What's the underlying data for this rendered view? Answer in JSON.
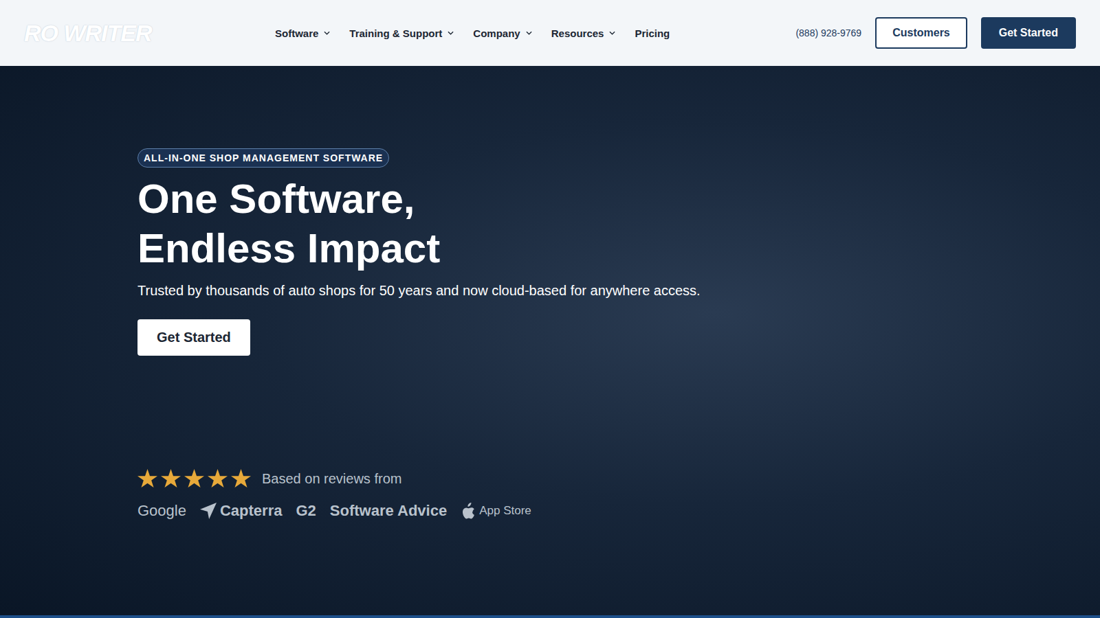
{
  "logo": "RO WRITER",
  "nav": [
    {
      "label": "Software",
      "dropdown": true
    },
    {
      "label": "Training & Support",
      "dropdown": true
    },
    {
      "label": "Company",
      "dropdown": true
    },
    {
      "label": "Resources",
      "dropdown": true
    },
    {
      "label": "Pricing",
      "dropdown": false
    }
  ],
  "phone": "(888) 928-9769",
  "header_buttons": [
    "Customers",
    "Get Started"
  ],
  "hero": {
    "badge": "ALL-IN-ONE SHOP MANAGEMENT SOFTWARE",
    "headline": [
      "One Software,",
      "Endless Impact"
    ],
    "subtitle": "Trusted by thousands of auto shops for 50 years and now cloud-based for anywhere access.",
    "cta": "Get Started"
  },
  "reviews": {
    "stars": 5,
    "label": "Based on reviews from",
    "sources": [
      "Google",
      "Capterra",
      "G2",
      "Software Advice",
      "App Store"
    ]
  }
}
